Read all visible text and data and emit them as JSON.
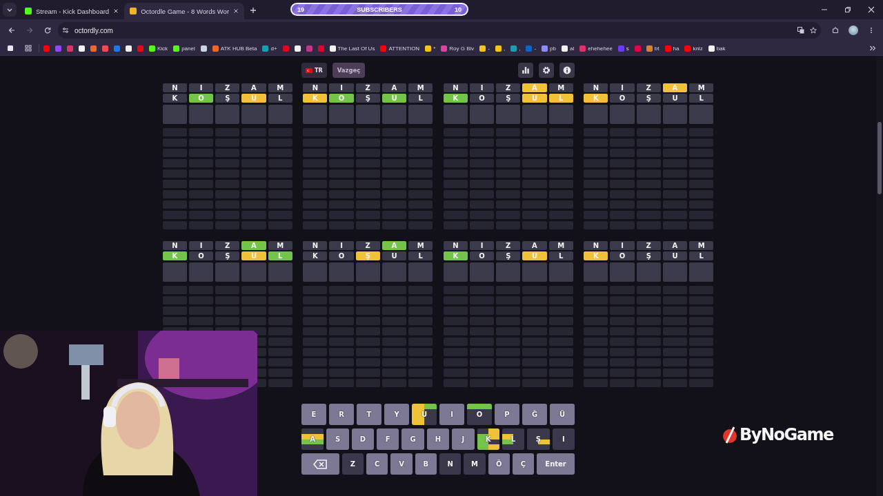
{
  "browser": {
    "tabs": [
      {
        "title": "Stream - Kick Dashboard",
        "selected": false,
        "color": "#53fc18"
      },
      {
        "title": "Octordle Game - 8 Words Wor",
        "selected": true,
        "color": "#f0b429"
      }
    ],
    "goal_bar": {
      "start": "19",
      "label": "SUBSCRIBERS",
      "end": "10"
    },
    "address": "octordly.com",
    "bookmarks": [
      {
        "color": "#ff0000"
      },
      {
        "color": "#9146ff"
      },
      {
        "color": "#e1306c"
      },
      {
        "color": "#f2f2f2"
      },
      {
        "color": "#f26522"
      },
      {
        "color": "#ff4655"
      },
      {
        "color": "#1877f2"
      },
      {
        "color": "#f2f2f2"
      },
      {
        "color": "#e50914"
      },
      {
        "label": "Kick",
        "color": "#53fc18"
      },
      {
        "label": "panel",
        "color": "#53fc18"
      },
      {
        "color": "#c7d5e0"
      },
      {
        "label": "ATK HUB Beta",
        "color": "#f26522"
      },
      {
        "label": "d+",
        "color": "#1a9cb0"
      },
      {
        "color": "#e60023"
      },
      {
        "color": "#f2f2f2"
      },
      {
        "color": "#c13584"
      },
      {
        "color": "#e4002b"
      },
      {
        "label": "The Last Of Us",
        "color": "#f2f2f2"
      },
      {
        "label": "ATTENTION",
        "color": "#ff0000"
      },
      {
        "label": "*",
        "color": "#f5c518"
      },
      {
        "label": "Roy G Biv",
        "color": "#e040a0"
      },
      {
        "label": "-",
        "color": "#f5c518"
      },
      {
        "label": ",",
        "color": "#f5c518"
      },
      {
        "label": ",",
        "color": "#1a9cb0"
      },
      {
        "label": "-",
        "color": "#0a66c2"
      },
      {
        "label": "pb",
        "color": "#8c8cff"
      },
      {
        "label": "al",
        "color": "#f2f2f2"
      },
      {
        "label": "ehehehee",
        "color": "#e1306c"
      },
      {
        "label": "s",
        "color": "#6a3cff"
      },
      {
        "color": "#e6004c"
      },
      {
        "label": "bt",
        "color": "#d9822b"
      },
      {
        "label": "ha",
        "color": "#ff0000"
      },
      {
        "label": "knlz",
        "color": "#ff0000"
      },
      {
        "label": "bak",
        "color": "#f2f2f2"
      }
    ]
  },
  "game": {
    "language": "TR",
    "give_up": "Vazgeç",
    "boards": [
      {
        "guesses": [
          {
            "tiles": [
              {
                "letter": "N",
                "color": "#3b3a4b"
              },
              {
                "letter": "I",
                "color": "#3b3a4b"
              },
              {
                "letter": "Z",
                "color": "#3b3a4b"
              },
              {
                "letter": "A",
                "color": "#3b3a4b"
              },
              {
                "letter": "M",
                "color": "#3b3a4b"
              }
            ]
          },
          {
            "tiles": [
              {
                "letter": "K",
                "color": "#3b3a4b"
              },
              {
                "letter": "O",
                "color": "#74c34a"
              },
              {
                "letter": "Ş",
                "color": "#3b3a4b"
              },
              {
                "letter": "U",
                "color": "#efc239"
              },
              {
                "letter": "L",
                "color": "#3b3a4b"
              }
            ]
          }
        ]
      },
      {
        "guesses": [
          {
            "tiles": [
              {
                "letter": "N",
                "color": "#3b3a4b"
              },
              {
                "letter": "I",
                "color": "#3b3a4b"
              },
              {
                "letter": "Z",
                "color": "#3b3a4b"
              },
              {
                "letter": "A",
                "color": "#3b3a4b"
              },
              {
                "letter": "M",
                "color": "#3b3a4b"
              }
            ]
          },
          {
            "tiles": [
              {
                "letter": "K",
                "color": "#efc239"
              },
              {
                "letter": "O",
                "color": "#74c34a"
              },
              {
                "letter": "Ş",
                "color": "#3b3a4b"
              },
              {
                "letter": "U",
                "color": "#74c34a"
              },
              {
                "letter": "L",
                "color": "#3b3a4b"
              }
            ]
          }
        ]
      },
      {
        "guesses": [
          {
            "tiles": [
              {
                "letter": "N",
                "color": "#3b3a4b"
              },
              {
                "letter": "I",
                "color": "#3b3a4b"
              },
              {
                "letter": "Z",
                "color": "#3b3a4b"
              },
              {
                "letter": "A",
                "color": "#efc239"
              },
              {
                "letter": "M",
                "color": "#3b3a4b"
              }
            ]
          },
          {
            "tiles": [
              {
                "letter": "K",
                "color": "#74c34a"
              },
              {
                "letter": "O",
                "color": "#3b3a4b"
              },
              {
                "letter": "Ş",
                "color": "#3b3a4b"
              },
              {
                "letter": "U",
                "color": "#efc239"
              },
              {
                "letter": "L",
                "color": "#efc239"
              }
            ]
          }
        ]
      },
      {
        "guesses": [
          {
            "tiles": [
              {
                "letter": "N",
                "color": "#3b3a4b"
              },
              {
                "letter": "I",
                "color": "#3b3a4b"
              },
              {
                "letter": "Z",
                "color": "#3b3a4b"
              },
              {
                "letter": "A",
                "color": "#efc239"
              },
              {
                "letter": "M",
                "color": "#3b3a4b"
              }
            ]
          },
          {
            "tiles": [
              {
                "letter": "K",
                "color": "#efc239"
              },
              {
                "letter": "O",
                "color": "#3b3a4b"
              },
              {
                "letter": "Ş",
                "color": "#3b3a4b"
              },
              {
                "letter": "U",
                "color": "#3b3a4b"
              },
              {
                "letter": "L",
                "color": "#3b3a4b"
              }
            ]
          }
        ]
      },
      {
        "guesses": [
          {
            "tiles": [
              {
                "letter": "N",
                "color": "#3b3a4b"
              },
              {
                "letter": "I",
                "color": "#3b3a4b"
              },
              {
                "letter": "Z",
                "color": "#3b3a4b"
              },
              {
                "letter": "A",
                "color": "#74c34a"
              },
              {
                "letter": "M",
                "color": "#3b3a4b"
              }
            ]
          },
          {
            "tiles": [
              {
                "letter": "K",
                "color": "#74c34a"
              },
              {
                "letter": "O",
                "color": "#3b3a4b"
              },
              {
                "letter": "Ş",
                "color": "#3b3a4b"
              },
              {
                "letter": "U",
                "color": "#efc239"
              },
              {
                "letter": "L",
                "color": "#74c34a"
              }
            ]
          }
        ]
      },
      {
        "guesses": [
          {
            "tiles": [
              {
                "letter": "N",
                "color": "#3b3a4b"
              },
              {
                "letter": "I",
                "color": "#3b3a4b"
              },
              {
                "letter": "Z",
                "color": "#3b3a4b"
              },
              {
                "letter": "A",
                "color": "#74c34a"
              },
              {
                "letter": "M",
                "color": "#3b3a4b"
              }
            ]
          },
          {
            "tiles": [
              {
                "letter": "K",
                "color": "#3b3a4b"
              },
              {
                "letter": "O",
                "color": "#3b3a4b"
              },
              {
                "letter": "Ş",
                "color": "#efc239"
              },
              {
                "letter": "U",
                "color": "#3b3a4b"
              },
              {
                "letter": "L",
                "color": "#3b3a4b"
              }
            ]
          }
        ]
      },
      {
        "guesses": [
          {
            "tiles": [
              {
                "letter": "N",
                "color": "#3b3a4b"
              },
              {
                "letter": "I",
                "color": "#3b3a4b"
              },
              {
                "letter": "Z",
                "color": "#3b3a4b"
              },
              {
                "letter": "A",
                "color": "#3b3a4b"
              },
              {
                "letter": "M",
                "color": "#3b3a4b"
              }
            ]
          },
          {
            "tiles": [
              {
                "letter": "K",
                "color": "#74c34a"
              },
              {
                "letter": "O",
                "color": "#3b3a4b"
              },
              {
                "letter": "Ş",
                "color": "#3b3a4b"
              },
              {
                "letter": "U",
                "color": "#efc239"
              },
              {
                "letter": "L",
                "color": "#3b3a4b"
              }
            ]
          }
        ]
      },
      {
        "guesses": [
          {
            "tiles": [
              {
                "letter": "N",
                "color": "#3b3a4b"
              },
              {
                "letter": "I",
                "color": "#3b3a4b"
              },
              {
                "letter": "Z",
                "color": "#3b3a4b"
              },
              {
                "letter": "A",
                "color": "#3b3a4b"
              },
              {
                "letter": "M",
                "color": "#3b3a4b"
              }
            ]
          },
          {
            "tiles": [
              {
                "letter": "K",
                "color": "#efc239"
              },
              {
                "letter": "O",
                "color": "#3b3a4b"
              },
              {
                "letter": "Ş",
                "color": "#3b3a4b"
              },
              {
                "letter": "U",
                "color": "#3b3a4b"
              },
              {
                "letter": "L",
                "color": "#3b3a4b"
              }
            ]
          }
        ]
      }
    ],
    "keyboard": [
      [
        {
          "kind": "letter",
          "label": "E",
          "used": false
        },
        {
          "kind": "letter",
          "label": "R",
          "used": false
        },
        {
          "kind": "letter",
          "label": "T",
          "used": false
        },
        {
          "kind": "letter",
          "label": "Y",
          "used": false
        },
        {
          "kind": "letter",
          "label": "U",
          "used": true,
          "cells": [
            {
              "color": "#efc239"
            },
            {
              "color": "#74c34a"
            },
            {
              "color": "#efc239"
            },
            {
              "color": "#3b384b"
            },
            {
              "color": "#efc239"
            },
            {
              "color": "#3b384b"
            },
            {
              "color": "#efc239"
            },
            {
              "color": "#3b384b"
            }
          ]
        },
        {
          "kind": "letter",
          "label": "I",
          "used": false
        },
        {
          "kind": "letter",
          "label": "O",
          "used": true,
          "cells": [
            {
              "color": "#74c34a"
            },
            {
              "color": "#74c34a"
            },
            {
              "color": "#3b384b"
            },
            {
              "color": "#3b384b"
            },
            {
              "color": "#3b384b"
            },
            {
              "color": "#3b384b"
            },
            {
              "color": "#3b384b"
            },
            {
              "color": "#3b384b"
            }
          ]
        },
        {
          "kind": "letter",
          "label": "P",
          "used": false
        },
        {
          "kind": "letter",
          "label": "Ğ",
          "used": false
        },
        {
          "kind": "letter",
          "label": "Ü",
          "used": false
        }
      ],
      [
        {
          "kind": "letter",
          "label": "A",
          "used": true,
          "cells": [
            {
              "color": "#3b384b"
            },
            {
              "color": "#3b384b"
            },
            {
              "color": "#efc239"
            },
            {
              "color": "#efc239"
            },
            {
              "color": "#74c34a"
            },
            {
              "color": "#74c34a"
            },
            {
              "color": "#3b384b"
            },
            {
              "color": "#3b384b"
            }
          ]
        },
        {
          "kind": "letter",
          "label": "S",
          "used": false
        },
        {
          "kind": "letter",
          "label": "D",
          "used": false
        },
        {
          "kind": "letter",
          "label": "F",
          "used": false
        },
        {
          "kind": "letter",
          "label": "G",
          "used": false
        },
        {
          "kind": "letter",
          "label": "H",
          "used": false
        },
        {
          "kind": "letter",
          "label": "J",
          "used": false
        },
        {
          "kind": "letter",
          "label": "K",
          "used": true,
          "cells": [
            {
              "color": "#3b384b"
            },
            {
              "color": "#efc239"
            },
            {
              "color": "#74c34a"
            },
            {
              "color": "#efc239"
            },
            {
              "color": "#74c34a"
            },
            {
              "color": "#3b384b"
            },
            {
              "color": "#74c34a"
            },
            {
              "color": "#efc239"
            }
          ]
        },
        {
          "kind": "letter",
          "label": "L",
          "used": true,
          "cells": [
            {
              "color": "#3b384b"
            },
            {
              "color": "#3b384b"
            },
            {
              "color": "#efc239"
            },
            {
              "color": "#3b384b"
            },
            {
              "color": "#74c34a"
            },
            {
              "color": "#3b384b"
            },
            {
              "color": "#3b384b"
            },
            {
              "color": "#3b384b"
            }
          ]
        },
        {
          "kind": "letter",
          "label": "Ş",
          "used": true,
          "cells": [
            {
              "color": "#3b384b"
            },
            {
              "color": "#3b384b"
            },
            {
              "color": "#3b384b"
            },
            {
              "color": "#3b384b"
            },
            {
              "color": "#3b384b"
            },
            {
              "color": "#efc239"
            },
            {
              "color": "#3b384b"
            },
            {
              "color": "#3b384b"
            }
          ]
        },
        {
          "kind": "letter",
          "label": "I",
          "used": true
        }
      ],
      [
        {
          "kind": "backspace",
          "used": false
        },
        {
          "kind": "letter",
          "label": "Z",
          "used": true
        },
        {
          "kind": "letter",
          "label": "C",
          "used": false
        },
        {
          "kind": "letter",
          "label": "V",
          "used": false
        },
        {
          "kind": "letter",
          "label": "B",
          "used": false
        },
        {
          "kind": "letter",
          "label": "N",
          "used": true
        },
        {
          "kind": "letter",
          "label": "M",
          "used": true
        },
        {
          "kind": "letter",
          "label": "Ö",
          "used": false
        },
        {
          "kind": "letter",
          "label": "Ç",
          "used": false
        },
        {
          "kind": "enter",
          "label": "Enter",
          "used": false
        }
      ]
    ]
  },
  "overlay_logo": "ByNoGame"
}
